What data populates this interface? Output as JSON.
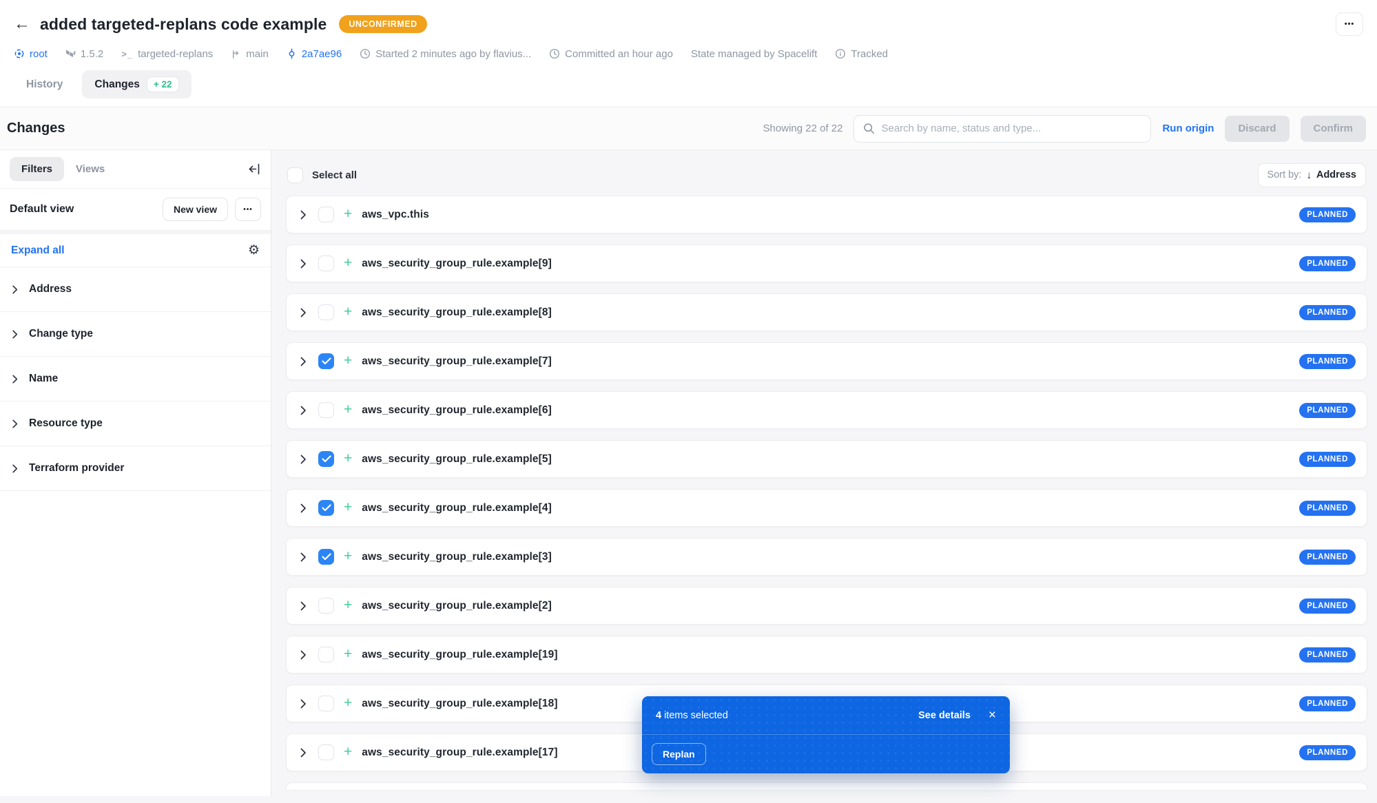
{
  "header": {
    "title": "added targeted-replans code example",
    "status_badge": "UNCONFIRMED",
    "menu_icon": "•••",
    "back_icon": "←",
    "meta": [
      {
        "label": "root"
      },
      {
        "label": "1.5.2"
      },
      {
        "label": "targeted-replans"
      },
      {
        "label": "main"
      },
      {
        "label": "2a7ae96"
      },
      {
        "label": "Started 2 minutes ago by flavius..."
      },
      {
        "label": "Committed an hour ago"
      },
      {
        "label": "State managed by Spacelift"
      },
      {
        "label": "Tracked"
      }
    ],
    "tabs": [
      {
        "label": "History"
      },
      {
        "label": "Changes",
        "badge": "+ 22"
      }
    ]
  },
  "toolbar": {
    "title": "Changes",
    "showing": "Showing 22 of 22",
    "search_placeholder": "Search by name, status and type...",
    "run_origin_label": "Run origin",
    "discard_label": "Discard",
    "confirm_label": "Confirm"
  },
  "sidebar": {
    "tabs": [
      "Filters",
      "Views"
    ],
    "default_view_label": "Default view",
    "new_view_label": "New view",
    "more_icon": "•••",
    "expand_all_label": "Expand all",
    "gear_icon": "⚙",
    "sections": [
      "Address",
      "Change type",
      "Name",
      "Resource type",
      "Terraform provider"
    ]
  },
  "list": {
    "select_all_label": "Select all",
    "sort_by_label": "Sort by:",
    "sort_arrow": "↓",
    "sort_value": "Address",
    "rows": [
      {
        "name": "aws_vpc.this",
        "checked": false,
        "status": "PLANNED"
      },
      {
        "name": "aws_security_group_rule.example[9]",
        "checked": false,
        "status": "PLANNED"
      },
      {
        "name": "aws_security_group_rule.example[8]",
        "checked": false,
        "status": "PLANNED"
      },
      {
        "name": "aws_security_group_rule.example[7]",
        "checked": true,
        "status": "PLANNED"
      },
      {
        "name": "aws_security_group_rule.example[6]",
        "checked": false,
        "status": "PLANNED"
      },
      {
        "name": "aws_security_group_rule.example[5]",
        "checked": true,
        "status": "PLANNED"
      },
      {
        "name": "aws_security_group_rule.example[4]",
        "checked": true,
        "status": "PLANNED"
      },
      {
        "name": "aws_security_group_rule.example[3]",
        "checked": true,
        "status": "PLANNED"
      },
      {
        "name": "aws_security_group_rule.example[2]",
        "checked": false,
        "status": "PLANNED"
      },
      {
        "name": "aws_security_group_rule.example[19]",
        "checked": false,
        "status": "PLANNED"
      },
      {
        "name": "aws_security_group_rule.example[18]",
        "checked": false,
        "status": "PLANNED"
      },
      {
        "name": "aws_security_group_rule.example[17]",
        "checked": false,
        "status": "PLANNED"
      }
    ]
  },
  "toast": {
    "count": "4",
    "message": "items selected",
    "see_details_label": "See details",
    "close_icon": "×",
    "replan_label": "Replan"
  },
  "colors": {
    "accent_blue": "#2273f2",
    "toast_blue": "#0e66e2",
    "checked_blue": "#2b85f6",
    "badge_blue": "#2472f2",
    "green": "#3fcf98",
    "orange": "#f1a11b"
  }
}
